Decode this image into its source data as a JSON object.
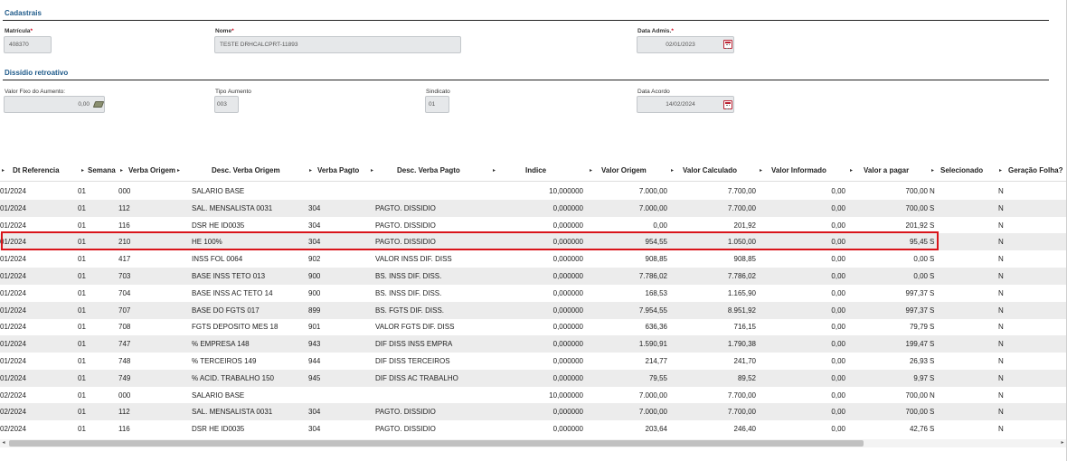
{
  "cadastrais": {
    "title": "Cadastrais",
    "matricula": {
      "label": "Matrícula",
      "value": "408370"
    },
    "nome": {
      "label": "Nome",
      "value": "TESTE DRHCALCPRT-11893"
    },
    "data_admis": {
      "label": "Data Admis.",
      "value": "02/01/2023"
    },
    "required_mark": "*"
  },
  "dissidio": {
    "title": "Dissídio retroativo",
    "valor_fixo": {
      "label": "Valor Fixo do Aumento:",
      "value": "0,00"
    },
    "tipo_aumento": {
      "label": "Tipo Aumento",
      "value": "003"
    },
    "sindicato": {
      "label": "Sindicato",
      "value": "01"
    },
    "data_acordo": {
      "label": "Data Acordo",
      "value": "14/02/2024"
    }
  },
  "grid": {
    "sort_glyph": "▸",
    "columns": [
      "Dt Referencia",
      "Semana",
      "Verba Origem",
      "Desc. Verba Origem",
      "Verba Pagto",
      "Desc. Verba Pagto",
      "Indice",
      "Valor Origem",
      "Valor Calculado",
      "Valor Informado",
      "Valor a pagar",
      "Selecionado",
      "Geração Folha?"
    ],
    "rows": [
      [
        "01/2024",
        "01",
        "000",
        "SALARIO BASE",
        "",
        "",
        "10,000000",
        "7.000,00",
        "7.700,00",
        "0,00",
        "700,00",
        "N",
        "N"
      ],
      [
        "01/2024",
        "01",
        "112",
        "SAL. MENSALISTA 0031",
        "304",
        "PAGTO. DISSIDIO",
        "0,000000",
        "7.000,00",
        "7.700,00",
        "0,00",
        "700,00",
        "S",
        "N"
      ],
      [
        "01/2024",
        "01",
        "116",
        "DSR HE ID0035",
        "304",
        "PAGTO. DISSIDIO",
        "0,000000",
        "0,00",
        "201,92",
        "0,00",
        "201,92",
        "S",
        "N"
      ],
      [
        "01/2024",
        "01",
        "210",
        "HE 100%",
        "304",
        "PAGTO. DISSIDIO",
        "0,000000",
        "954,55",
        "1.050,00",
        "0,00",
        "95,45",
        "S",
        "N"
      ],
      [
        "01/2024",
        "01",
        "417",
        "INSS FOL 0064",
        "902",
        "VALOR INSS DIF. DISS",
        "0,000000",
        "908,85",
        "908,85",
        "0,00",
        "0,00",
        "S",
        "N"
      ],
      [
        "01/2024",
        "01",
        "703",
        "BASE INSS TETO 013",
        "900",
        "BS. INSS DIF. DISS.",
        "0,000000",
        "7.786,02",
        "7.786,02",
        "0,00",
        "0,00",
        "S",
        "N"
      ],
      [
        "01/2024",
        "01",
        "704",
        "BASE INSS AC TETO 14",
        "900",
        "BS. INSS DIF. DISS.",
        "0,000000",
        "168,53",
        "1.165,90",
        "0,00",
        "997,37",
        "S",
        "N"
      ],
      [
        "01/2024",
        "01",
        "707",
        "BASE DO FGTS 017",
        "899",
        "BS. FGTS DIF. DISS.",
        "0,000000",
        "7.954,55",
        "8.951,92",
        "0,00",
        "997,37",
        "S",
        "N"
      ],
      [
        "01/2024",
        "01",
        "708",
        "FGTS DEPOSITO MES 18",
        "901",
        "VALOR FGTS DIF. DISS",
        "0,000000",
        "636,36",
        "716,15",
        "0,00",
        "79,79",
        "S",
        "N"
      ],
      [
        "01/2024",
        "01",
        "747",
        "% EMPRESA 148",
        "943",
        "DIF DISS INSS EMPRA",
        "0,000000",
        "1.590,91",
        "1.790,38",
        "0,00",
        "199,47",
        "S",
        "N"
      ],
      [
        "01/2024",
        "01",
        "748",
        "% TERCEIROS 149",
        "944",
        "DIF DISS TERCEIROS",
        "0,000000",
        "214,77",
        "241,70",
        "0,00",
        "26,93",
        "S",
        "N"
      ],
      [
        "01/2024",
        "01",
        "749",
        "% ACID. TRABALHO 150",
        "945",
        "DIF DISS AC TRABALHO",
        "0,000000",
        "79,55",
        "89,52",
        "0,00",
        "9,97",
        "S",
        "N"
      ],
      [
        "02/2024",
        "01",
        "000",
        "SALARIO BASE",
        "",
        "",
        "10,000000",
        "7.000,00",
        "7.700,00",
        "0,00",
        "700,00",
        "N",
        "N"
      ],
      [
        "02/2024",
        "01",
        "112",
        "SAL. MENSALISTA 0031",
        "304",
        "PAGTO. DISSIDIO",
        "0,000000",
        "7.000,00",
        "7.700,00",
        "0,00",
        "700,00",
        "S",
        "N"
      ],
      [
        "02/2024",
        "01",
        "116",
        "DSR HE ID0035",
        "304",
        "PAGTO. DISSIDIO",
        "0,000000",
        "203,64",
        "246,40",
        "0,00",
        "42,76",
        "S",
        "N"
      ]
    ],
    "highlighted_row": 3
  },
  "scrollbar": {
    "left_arrow": "◂",
    "right_arrow": "▸"
  },
  "colors": {
    "section_title": "#1e5a8a",
    "highlight_border": "#d9151b",
    "alt_row": "#ececec",
    "field_bg": "#e6e8ea"
  }
}
